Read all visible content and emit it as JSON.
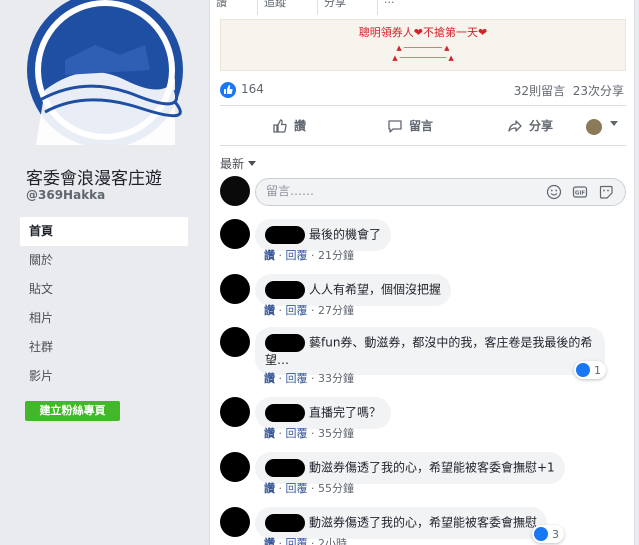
{
  "sidebar": {
    "logo_text": "浪漫客庄遊",
    "page_name": "客委會浪漫客庄遊",
    "handle": "@369Hakka",
    "nav": [
      {
        "label": "首頁",
        "active": true
      },
      {
        "label": "關於",
        "active": false
      },
      {
        "label": "貼文",
        "active": false
      },
      {
        "label": "相片",
        "active": false
      },
      {
        "label": "社群",
        "active": false
      },
      {
        "label": "影片",
        "active": false
      }
    ],
    "create_fan_page": "建立粉絲專頁"
  },
  "post": {
    "top_actions": [
      "讚",
      "追蹤",
      "分享",
      "···"
    ],
    "image_headline": "聰明領券人❤不搶第一天❤",
    "stats": {
      "likes": "164",
      "comments": "32則留言",
      "shares": "23次分享"
    },
    "actions": {
      "like": "讚",
      "comment": "留言",
      "share": "分享"
    },
    "sort_label": "最新",
    "composer_placeholder": "留言……"
  },
  "comments": [
    {
      "text": "最後的機會了",
      "time": "21分鐘",
      "reactions": null
    },
    {
      "text": "人人有希望，個個沒把握",
      "time": "27分鐘",
      "reactions": null
    },
    {
      "text": "藝fun券、動滋券，都沒中的我，客庄卷是我最後的希望…",
      "time": "33分鐘",
      "reactions": "1"
    },
    {
      "text": "直播完了嗎？",
      "time": "35分鐘",
      "reactions": null
    },
    {
      "text": "動滋券傷透了我的心，希望能被客委會撫慰+1",
      "time": "55分鐘",
      "reactions": null
    },
    {
      "text": "動滋券傷透了我的心，希望能被客委會撫慰",
      "time": "2小時",
      "reactions": "3"
    }
  ],
  "comment_actions": {
    "like": "讚",
    "reply": "回覆",
    "sep": "·"
  },
  "colors": {
    "facebook_blue": "#1877f2",
    "link_blue": "#385898",
    "green_button": "#42b72a",
    "headline_red": "#d2232a"
  }
}
